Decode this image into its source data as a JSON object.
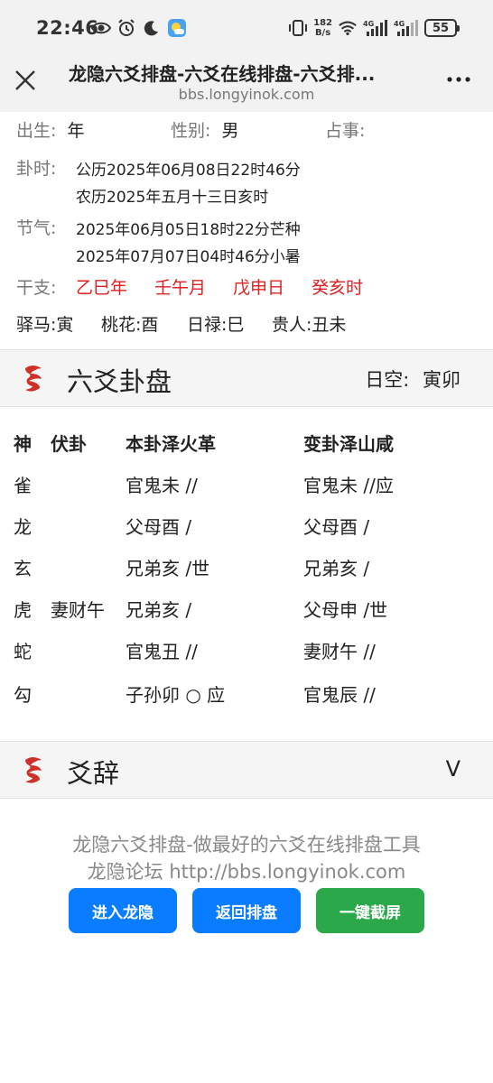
{
  "status": {
    "time": "22:46",
    "net_speed_value": "182",
    "net_speed_unit": "B/s",
    "battery": "55",
    "net1": "4G",
    "net2": "4G"
  },
  "browser": {
    "title": "龙隐六爻排盘-六爻在线排盘-六爻排...",
    "url": "bbs.longyinok.com"
  },
  "info": {
    "birth_label": "出生:",
    "birth_value": "年",
    "gender_label": "性别:",
    "gender_value": "男",
    "matter_label": "占事:",
    "gua_time_label": "卦时:",
    "gua_time_solar": "公历2025年06月08日22时46分",
    "gua_time_lunar": "农历2025年五月十三日亥时",
    "jieqi_label": "节气:",
    "jieqi_1": "2025年06月05日18时22分芒种",
    "jieqi_2": "2025年07月07日04时46分小暑",
    "ganzhi_label": "干支:",
    "ganzhi": [
      "乙巳年",
      "壬午月",
      "戊申日",
      "癸亥时"
    ],
    "shensha": [
      "驿马:寅",
      "桃花:酉",
      "日禄:巳",
      "贵人:丑未"
    ]
  },
  "section1": {
    "title": "六爻卦盘",
    "kong_label": "日空:",
    "kong_value": "寅卯"
  },
  "table": {
    "headers": [
      "神",
      "伏卦",
      "本卦泽火革",
      "变卦泽山咸"
    ],
    "rows": [
      [
        "雀",
        "",
        "官鬼未 //",
        "官鬼未 //应"
      ],
      [
        "龙",
        "",
        "父母酉 /",
        "父母酉 /"
      ],
      [
        "玄",
        "",
        "兄弟亥 /世",
        "兄弟亥 /"
      ],
      [
        "虎",
        "妻财午",
        "兄弟亥 /",
        "父母申 /世"
      ],
      [
        "蛇",
        "",
        "官鬼丑 //",
        "妻财午 //"
      ],
      [
        "勾",
        "",
        "子孙卯 ○ 应",
        "官鬼辰 //"
      ]
    ]
  },
  "section2": {
    "title": "爻辞",
    "chevron": "V"
  },
  "footer": {
    "line1": "龙隐六爻排盘-做最好的六爻在线排盘工具",
    "line2": "龙隐论坛 http://bbs.longyinok.com",
    "btn_enter": "进入龙隐",
    "btn_back": "返回排盘",
    "btn_screenshot": "一键截屏"
  },
  "colors": {
    "accent_blue": "#0a7cff",
    "accent_green": "#2aa84a",
    "ganzhi_red": "#e02020"
  }
}
